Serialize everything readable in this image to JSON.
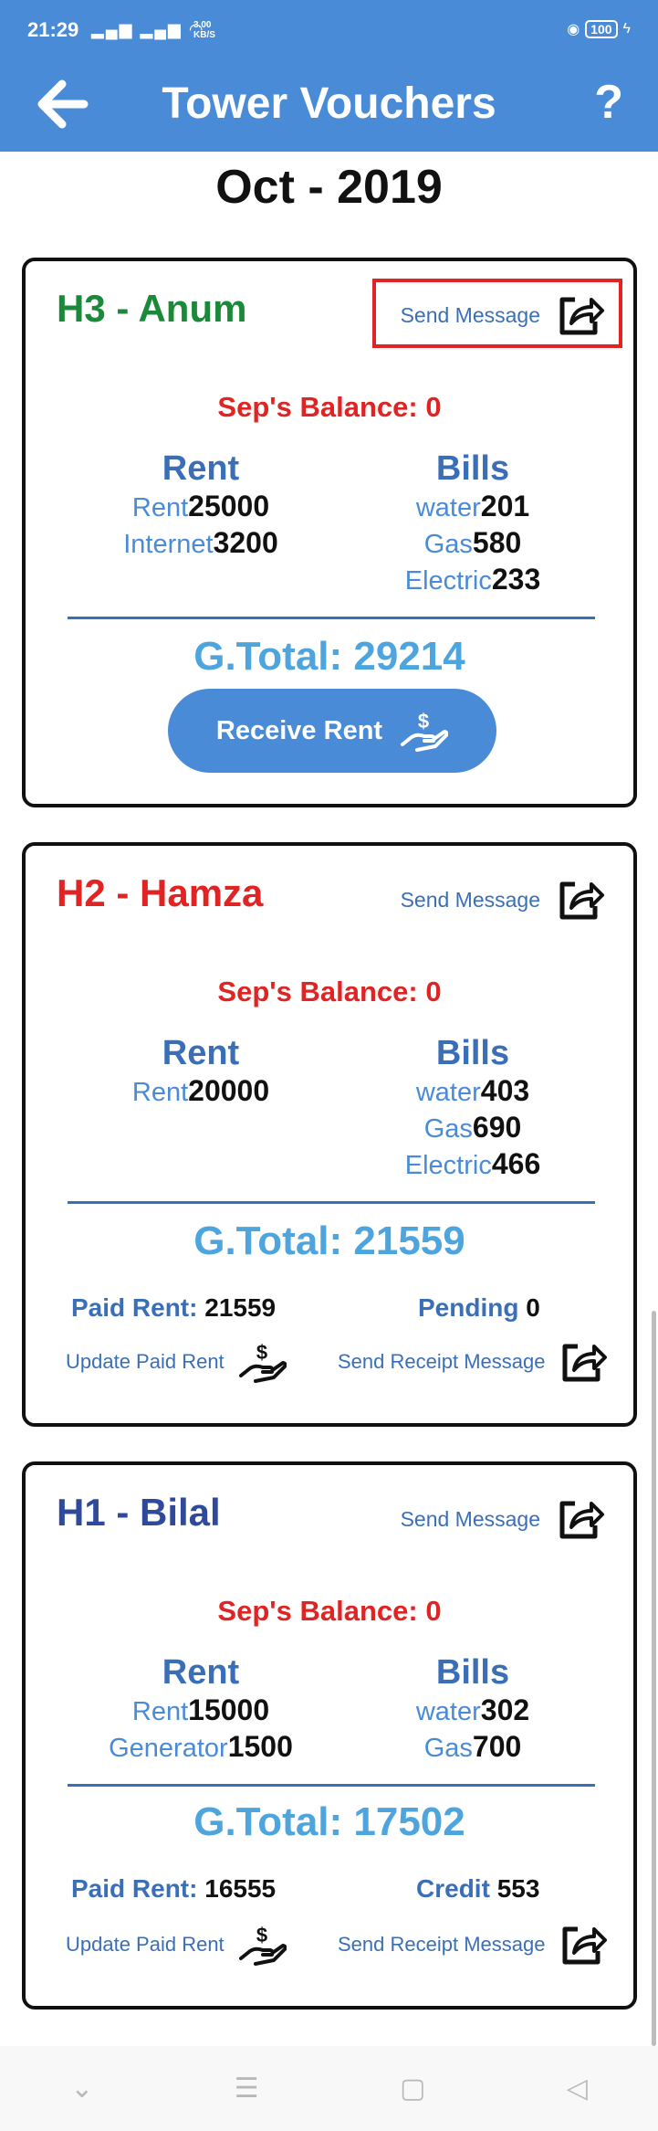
{
  "status": {
    "time": "21:29",
    "speed_value": "3.00",
    "speed_unit": "KB/S",
    "battery": "100"
  },
  "app": {
    "title": "Tower Vouchers",
    "help": "?"
  },
  "month": "Oct - 2019",
  "colors": {
    "appbar": "#4a8bd8",
    "green": "#1a8a3a",
    "red": "#e02424",
    "navy": "#2f4a9a",
    "light_blue": "#4ea5dd"
  },
  "cards": [
    {
      "title": "H3 - Anum",
      "send_message": "Send Message",
      "balance": "Sep's Balance: 0",
      "rent_head": "Rent",
      "rent_items": [
        {
          "label": "Rent",
          "value": "25000"
        },
        {
          "label": "Internet",
          "value": "3200"
        }
      ],
      "bills_head": "Bills",
      "bills_items": [
        {
          "label": "water",
          "value": "201"
        },
        {
          "label": "Gas",
          "value": "580"
        },
        {
          "label": "Electric",
          "value": "233"
        }
      ],
      "gtotal": "G.Total: 29214",
      "receive_label": "Receive Rent"
    },
    {
      "title": "H2 - Hamza",
      "send_message": "Send Message",
      "balance": "Sep's Balance: 0",
      "rent_head": "Rent",
      "rent_items": [
        {
          "label": "Rent",
          "value": "20000"
        }
      ],
      "bills_head": "Bills",
      "bills_items": [
        {
          "label": "water",
          "value": "403"
        },
        {
          "label": "Gas",
          "value": "690"
        },
        {
          "label": "Electric",
          "value": "466"
        }
      ],
      "gtotal": "G.Total: 21559",
      "paid_label": "Paid Rent:",
      "paid_value": "21559",
      "status_label": "Pending",
      "status_value": "0",
      "update_label": "Update Paid Rent",
      "receipt_label": "Send Receipt Message"
    },
    {
      "title": "H1 - Bilal",
      "send_message": "Send Message",
      "balance": "Sep's Balance: 0",
      "rent_head": "Rent",
      "rent_items": [
        {
          "label": "Rent",
          "value": "15000"
        },
        {
          "label": "Generator",
          "value": "1500"
        }
      ],
      "bills_head": "Bills",
      "bills_items": [
        {
          "label": "water",
          "value": "302"
        },
        {
          "label": "Gas",
          "value": "700"
        }
      ],
      "gtotal": "G.Total: 17502",
      "paid_label": "Paid Rent:",
      "paid_value": "16555",
      "status_label": "Credit",
      "status_value": "553",
      "update_label": "Update Paid Rent",
      "receipt_label": "Send Receipt Message"
    }
  ]
}
